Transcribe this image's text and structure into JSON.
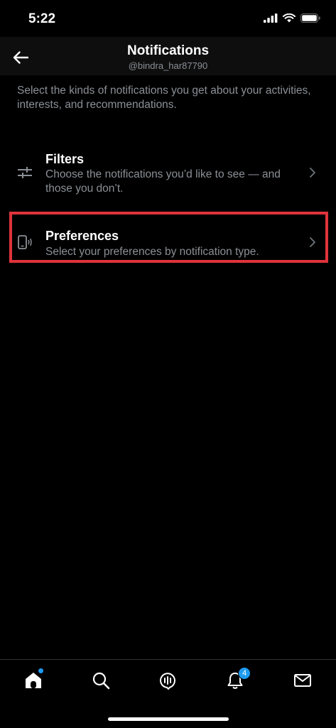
{
  "status": {
    "time": "5:22"
  },
  "header": {
    "title": "Notifications",
    "handle": "@bindra_har87790"
  },
  "intro": "Select the kinds of notifications you get about your activities, interests, and recommendations.",
  "items": [
    {
      "title": "Filters",
      "subtitle": "Choose the notifications you’d like to see — and those you don’t.",
      "icon": "sliders-icon"
    },
    {
      "title": "Preferences",
      "subtitle": "Select your preferences by notification type.",
      "icon": "phone-vibrate-icon"
    }
  ],
  "tabbar": {
    "tabs": [
      "home-icon",
      "search-icon",
      "spaces-icon",
      "bell-icon",
      "mail-icon"
    ],
    "notification_count": "4"
  },
  "colors": {
    "accent": "#1d9bf0",
    "highlight": "#e0333c",
    "muted": "#8b9096"
  }
}
